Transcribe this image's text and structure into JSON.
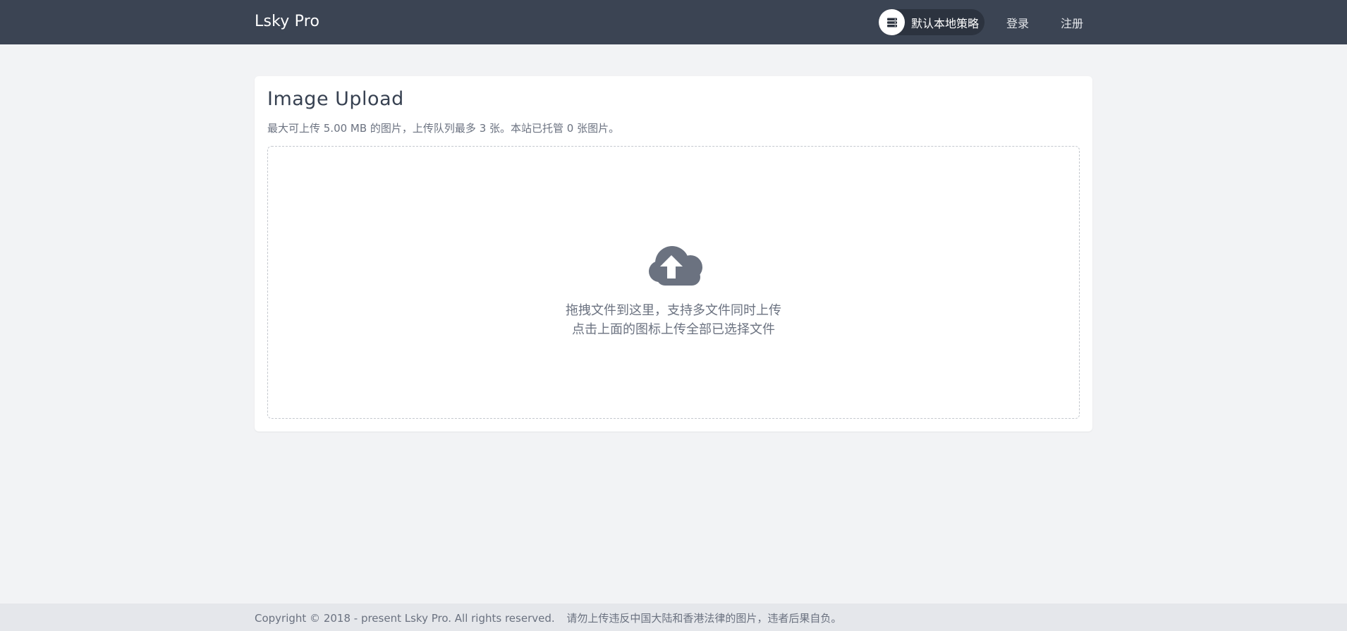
{
  "header": {
    "brand": "Lsky Pro",
    "strategy_label": "默认本地策略",
    "strategy_icon": "server-icon",
    "login_label": "登录",
    "register_label": "注册"
  },
  "upload": {
    "title": "Image Upload",
    "subtitle": "最大可上传 5.00 MB 的图片，上传队列最多 3 张。本站已托管 0 张图片。",
    "icon": "cloud-upload-icon",
    "drop_line_1": "拖拽文件到这里，支持多文件同时上传",
    "drop_line_2": "点击上面的图标上传全部已选择文件"
  },
  "footer": {
    "copyright": "Copyright © 2018 - present Lsky Pro. All rights reserved.",
    "notice": "请勿上传违反中国大陆和香港法律的图片，违者后果自负。"
  },
  "colors": {
    "header_bg": "#3b4453",
    "page_bg": "#f2f3f5",
    "card_bg": "#ffffff",
    "icon_gray": "#6b7280"
  }
}
